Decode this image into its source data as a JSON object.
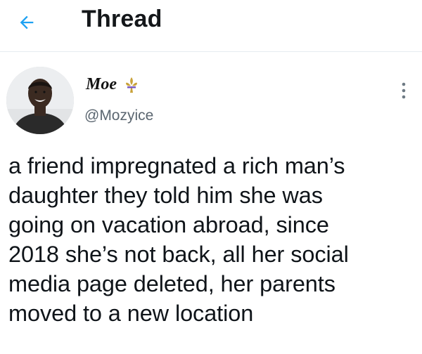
{
  "header": {
    "back_icon": "arrow-left-icon",
    "title": "Thread",
    "accent_color": "#1da1f2"
  },
  "tweet": {
    "author": {
      "display_name": "Moe",
      "badge_icon": "fleur-de-lis-emoji-icon",
      "handle": "@Mozyice",
      "avatar_icon": "profile-photo"
    },
    "more_icon": "more-vertical-icon",
    "text": "a friend impregnated a rich man’s\ndaughter they told him she was\ngoing on vacation abroad, since\n2018 she’s not back, all her social\nmedia page deleted, her parents\nmoved to a new location"
  }
}
